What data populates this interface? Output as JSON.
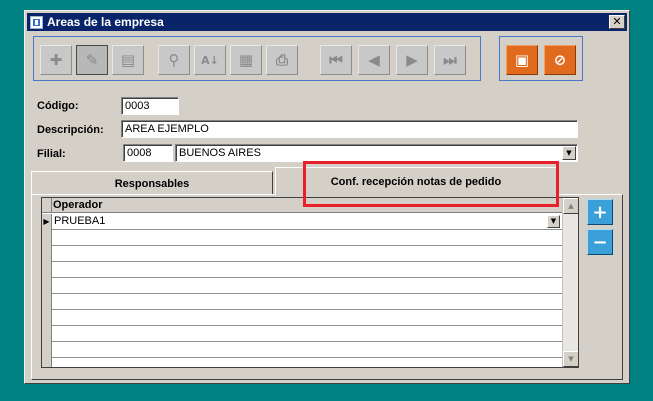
{
  "window": {
    "title": "Areas de la empresa",
    "close_glyph": "✕"
  },
  "toolbar": {
    "buttons": [
      {
        "name": "add-icon",
        "glyph": "✚"
      },
      {
        "name": "edit-icon",
        "glyph": "✎"
      },
      {
        "name": "delete-icon",
        "glyph": "▤"
      },
      {
        "name": "search-icon",
        "glyph": "⚲"
      },
      {
        "name": "sort-icon",
        "glyph": "A↓"
      },
      {
        "name": "report-icon",
        "glyph": "▦"
      },
      {
        "name": "print-icon",
        "glyph": "⎙"
      },
      {
        "name": "first-record-icon",
        "glyph": "⏮"
      },
      {
        "name": "previous-record-icon",
        "glyph": "◀"
      },
      {
        "name": "next-record-icon",
        "glyph": "▶"
      },
      {
        "name": "last-record-icon",
        "glyph": "⏭"
      }
    ],
    "save_glyph": "▣",
    "cancel_glyph": "⊘",
    "accent_color": "#e06a1e"
  },
  "form": {
    "codigo_label": "Código:",
    "codigo_value": "0003",
    "descripcion_label": "Descripción:",
    "descripcion_value": "AREA EJEMPLO",
    "filial_label": "Filial:",
    "filial_code": "0008",
    "filial_name": "BUENOS AIRES",
    "dropdown_glyph": "▼"
  },
  "tabs": [
    {
      "label": "Responsables"
    },
    {
      "label": "Conf. recepción notas de pedido"
    }
  ],
  "grid": {
    "column_header": "Operador",
    "current_row_glyph": "▶",
    "rows": [
      "PRUEBA1",
      "",
      "",
      "",
      "",
      "",
      "",
      "",
      "",
      ""
    ],
    "scroll_up_glyph": "▲",
    "scroll_down_glyph": "▼"
  },
  "side_buttons": {
    "add_glyph": "+",
    "remove_glyph": "−"
  },
  "highlight_color": "#e8202a"
}
